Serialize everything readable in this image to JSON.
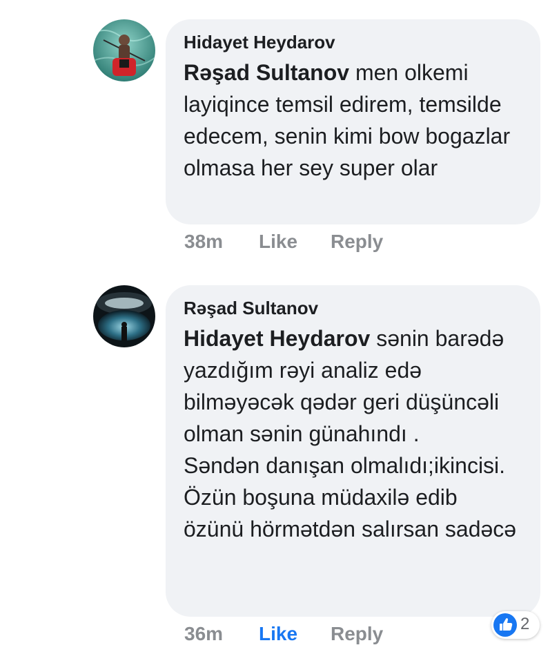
{
  "comments": [
    {
      "author": "Hidayet Heydarov",
      "mention": "Rəşad Sultanov",
      "text": " men olkemi layiqince temsil edirem, temsilde edecem, senin kimi bow bogazlar olmasa her sey super olar",
      "time": "38m",
      "like_label": "Like",
      "reply_label": "Reply"
    },
    {
      "author": "Rəşad Sultanov",
      "mention": "Hidayet Heydarov",
      "text": " sənin barədə yazdığım rəyi analiz edə bilməyəcək qədər geri düşüncəli olman sənin günahındı .\nSəndən danışan olmalıdı;ikincisi. Özün boşuna müdaxilə edib özünü hörmətdən salırsan sadəcə",
      "time": "36m",
      "like_label": "Like",
      "reply_label": "Reply",
      "reaction_count": "2"
    }
  ],
  "colors": {
    "bubble": "#f0f2f5",
    "meta": "#8a8d91",
    "accent": "#1877f2"
  },
  "icons": {
    "reaction": "thumbs-up-icon"
  }
}
